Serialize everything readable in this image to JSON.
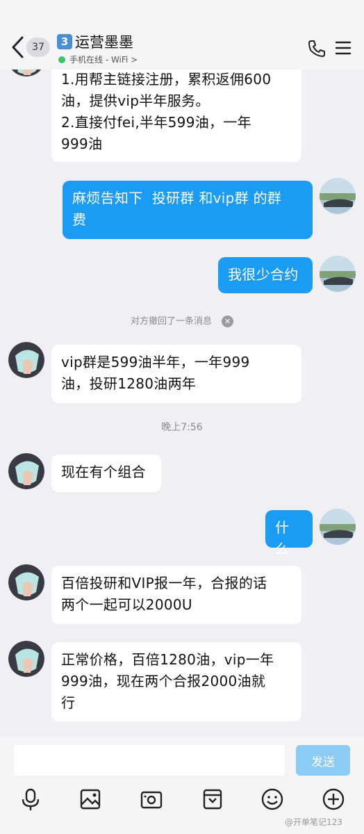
{
  "header": {
    "unread_count": "37",
    "chat_number": "3",
    "title": "运营墨墨",
    "status": "手机在线 - WiFi >"
  },
  "messages": [
    {
      "side": "in",
      "text": "1.用帮主链接注册，累积返佣600\n油，提供vip半年服务。\n2.直接付fei,半年599油，一年\n999油"
    },
    {
      "side": "out",
      "text": "麻烦告知下  投研群 和vip群 的群\n费"
    },
    {
      "side": "out",
      "text": "我很少合约"
    },
    {
      "side": "in",
      "text": "vip群是599油半年，一年999\n油，投研1280油两年"
    },
    {
      "side": "in",
      "text": "现在有个组合"
    },
    {
      "side": "out",
      "text": "什么"
    },
    {
      "side": "in",
      "text": "百倍投研和VIP报一年，合报的话\n两个一起可以2000U"
    },
    {
      "side": "in",
      "text": "正常价格，百倍1280油，vip一年\n999油，现在两个合报2000油就\n行"
    }
  ],
  "system": {
    "recall_notice": "对方撤回了一条消息",
    "timestamp": "晚上7:56"
  },
  "input": {
    "send_label": "发送",
    "placeholder": ""
  },
  "toolbar": [
    "microphone-icon",
    "image-icon",
    "camera-icon",
    "file-icon",
    "emoji-icon",
    "plus-icon"
  ],
  "watermark": "@开单笔记123",
  "colors": {
    "outgoing_bubble": "#1a9cf4",
    "incoming_bubble": "#ffffff",
    "background": "#f0f0f4",
    "send_button": "#8ccbf4"
  }
}
